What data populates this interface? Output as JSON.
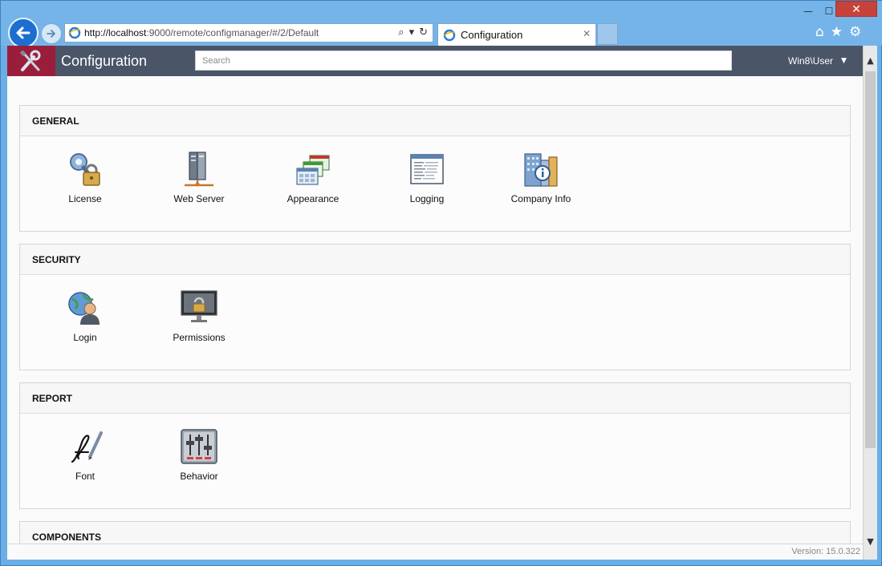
{
  "browser": {
    "address": {
      "host": "http://localhost",
      "path": ":9000/remote/configmanager/#/2/Default"
    },
    "tab_title": "Configuration",
    "window_controls": {
      "minimize": "—",
      "maximize": "☐",
      "close": "✕"
    },
    "toolbar": {
      "home": "⌂",
      "favorites": "★",
      "settings": "⚙"
    },
    "address_tools": {
      "search": "⌕",
      "dropdown": "▾",
      "refresh": "↻"
    },
    "tab_close": "✕"
  },
  "app": {
    "title": "Configuration",
    "search_placeholder": "Search",
    "user": "Win8\\User",
    "user_caret": "▼",
    "version": "Version: 15.0.322",
    "colors": {
      "header": "#4a5568",
      "logo": "#9b1d3c"
    }
  },
  "sections": {
    "general": {
      "title": "GENERAL",
      "items": [
        {
          "label": "License",
          "icon": "license-icon"
        },
        {
          "label": "Web Server",
          "icon": "web-server-icon"
        },
        {
          "label": "Appearance",
          "icon": "appearance-icon"
        },
        {
          "label": "Logging",
          "icon": "logging-icon"
        },
        {
          "label": "Company Info",
          "icon": "company-info-icon"
        }
      ]
    },
    "security": {
      "title": "SECURITY",
      "items": [
        {
          "label": "Login",
          "icon": "login-icon"
        },
        {
          "label": "Permissions",
          "icon": "permissions-icon"
        }
      ]
    },
    "report": {
      "title": "REPORT",
      "items": [
        {
          "label": "Font",
          "icon": "font-icon"
        },
        {
          "label": "Behavior",
          "icon": "behavior-icon"
        }
      ]
    },
    "components": {
      "title": "COMPONENTS"
    }
  },
  "scrollbar": {
    "up": "▲",
    "down": "▼"
  }
}
